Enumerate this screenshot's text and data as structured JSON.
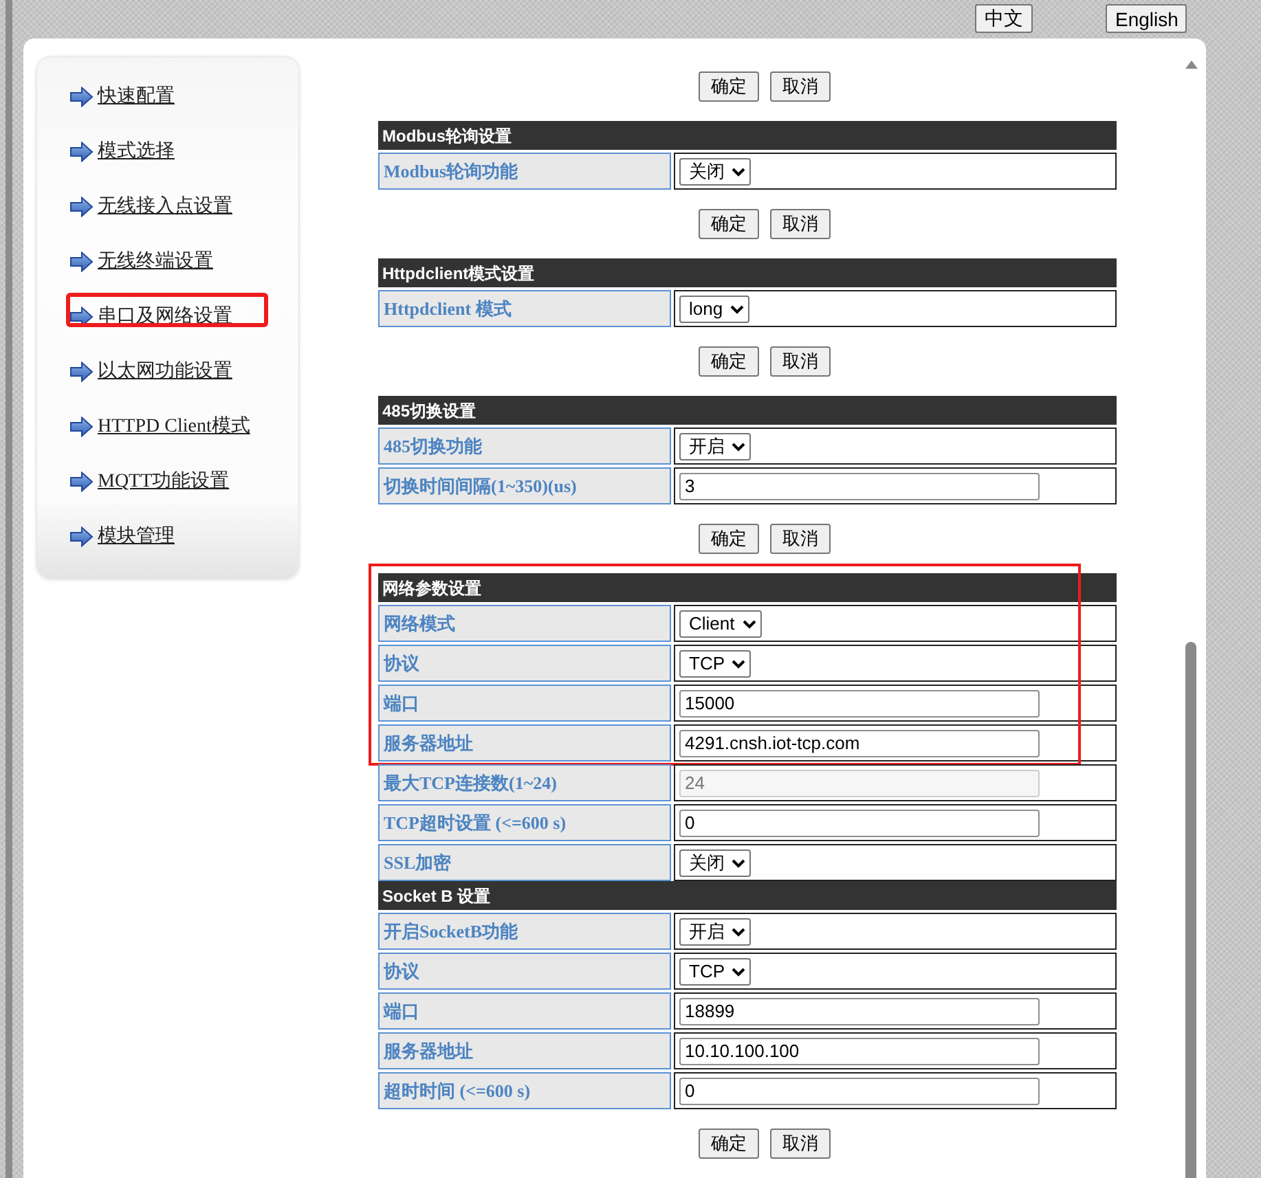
{
  "language_buttons": [
    "中文",
    "English"
  ],
  "sidebar": {
    "items": [
      {
        "label": "快速配置",
        "highlighted": false
      },
      {
        "label": "模式选择",
        "highlighted": false
      },
      {
        "label": "无线接入点设置",
        "highlighted": false
      },
      {
        "label": "无线终端设置",
        "highlighted": false
      },
      {
        "label": "串口及网络设置",
        "highlighted": true
      },
      {
        "label": "以太网功能设置",
        "highlighted": false
      },
      {
        "label": "HTTPD Client模式",
        "highlighted": false
      },
      {
        "label": "MQTT功能设置",
        "highlighted": false
      },
      {
        "label": "模块管理",
        "highlighted": false
      }
    ]
  },
  "content": [
    {
      "kind": "buttons",
      "buttons": [
        "确定",
        "取消"
      ]
    },
    {
      "kind": "section",
      "title": "Modbus轮询设置",
      "groups": [
        {
          "highlighted": false,
          "rows": [
            {
              "label": "Modbus轮询功能",
              "field": {
                "kind": "select",
                "value": "关闭"
              }
            }
          ]
        }
      ]
    },
    {
      "kind": "buttons",
      "buttons": [
        "确定",
        "取消"
      ]
    },
    {
      "kind": "section",
      "title": "Httpdclient模式设置",
      "groups": [
        {
          "highlighted": false,
          "rows": [
            {
              "label": "Httpdclient 模式",
              "field": {
                "kind": "select",
                "value": "long"
              }
            }
          ]
        }
      ]
    },
    {
      "kind": "buttons",
      "buttons": [
        "确定",
        "取消"
      ]
    },
    {
      "kind": "section",
      "title": "485切换设置",
      "groups": [
        {
          "highlighted": false,
          "rows": [
            {
              "label": "485切换功能",
              "field": {
                "kind": "select",
                "value": "开启"
              }
            },
            {
              "label": "切换时间间隔(1~350)(us)",
              "field": {
                "kind": "input",
                "value": "3",
                "disabled": false
              }
            }
          ]
        }
      ]
    },
    {
      "kind": "buttons",
      "buttons": [
        "确定",
        "取消"
      ]
    },
    {
      "kind": "section",
      "title": "网络参数设置",
      "groups": [
        {
          "highlighted": true,
          "rows": [
            {
              "label": "网络模式",
              "field": {
                "kind": "select",
                "value": "Client"
              }
            },
            {
              "label": "协议",
              "field": {
                "kind": "select",
                "value": "TCP"
              }
            },
            {
              "label": "端口",
              "field": {
                "kind": "input",
                "value": "15000",
                "disabled": false
              }
            },
            {
              "label": "服务器地址",
              "field": {
                "kind": "input",
                "value": "4291.cnsh.iot-tcp.com",
                "disabled": false
              }
            }
          ]
        },
        {
          "highlighted": false,
          "rows": [
            {
              "label": "最大TCP连接数(1~24)",
              "field": {
                "kind": "input",
                "value": "24",
                "disabled": true
              }
            },
            {
              "label": "TCP超时设置 (<=600 s)",
              "field": {
                "kind": "input",
                "value": "0",
                "disabled": false
              }
            },
            {
              "label": "SSL加密",
              "field": {
                "kind": "select",
                "value": "关闭"
              }
            }
          ]
        }
      ]
    },
    {
      "kind": "section",
      "title": "Socket B 设置",
      "groups": [
        {
          "highlighted": false,
          "rows": [
            {
              "label": "开启SocketB功能",
              "field": {
                "kind": "select",
                "value": "开启"
              }
            },
            {
              "label": "协议",
              "field": {
                "kind": "select",
                "value": "TCP"
              }
            },
            {
              "label": "端口",
              "field": {
                "kind": "input",
                "value": "18899",
                "disabled": false
              }
            },
            {
              "label": "服务器地址",
              "field": {
                "kind": "input",
                "value": "10.10.100.100",
                "disabled": false
              }
            },
            {
              "label": "超时时间 (<=600 s)",
              "field": {
                "kind": "input",
                "value": "0",
                "disabled": false
              }
            }
          ]
        }
      ]
    },
    {
      "kind": "buttons",
      "buttons": [
        "确定",
        "取消"
      ]
    }
  ]
}
